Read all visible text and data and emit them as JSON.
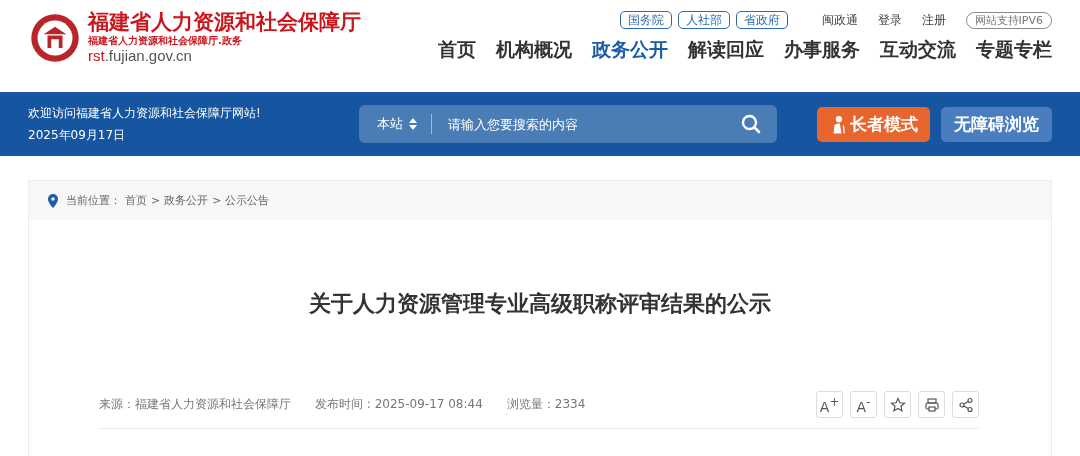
{
  "header": {
    "site_name": "福建省人力资源和社会保障厅",
    "subtitle": "福建省人力资源和社会保障厅.政务",
    "domain_prefix": "rst",
    "domain_rest": ".fujian.gov.cn",
    "gov_links": [
      "国务院",
      "人社部",
      "省政府"
    ],
    "user_links": [
      "闽政通",
      "登录",
      "注册"
    ],
    "ipv6_badge": "网站支持IPV6",
    "nav": [
      {
        "label": "首页",
        "selected": false
      },
      {
        "label": "机构概况",
        "selected": false
      },
      {
        "label": "政务公开",
        "selected": true
      },
      {
        "label": "解读回应",
        "selected": false
      },
      {
        "label": "办事服务",
        "selected": false
      },
      {
        "label": "互动交流",
        "selected": false
      },
      {
        "label": "专题专栏",
        "selected": false
      }
    ]
  },
  "banner": {
    "welcome": "欢迎访问福建省人力资源和社会保障厅网站!",
    "date": "2025年09月17日",
    "search": {
      "scope": "本站",
      "placeholder": "请输入您要搜索的内容"
    },
    "buttons": [
      {
        "label": "长者模式",
        "kind": "elder"
      },
      {
        "label": "无障碍浏览",
        "kind": "accessible"
      }
    ]
  },
  "breadcrumb": {
    "label": "当前位置：",
    "items": [
      "首页",
      "政务公开",
      "公示公告"
    ],
    "separator": ">"
  },
  "article": {
    "title": "关于人力资源管理专业高级职称评审结果的公示",
    "meta": [
      "来源：福建省人力资源和社会保障厅",
      "发布时间 : 2025-09-17 08:44",
      "浏览量：2334"
    ],
    "tools": [
      {
        "kind": "text",
        "label": "A$^{+}$"
      },
      {
        "kind": "text",
        "label": "A$^{-}$"
      },
      {
        "kind": "star"
      },
      {
        "kind": "print"
      },
      {
        "kind": "share"
      }
    ]
  }
}
